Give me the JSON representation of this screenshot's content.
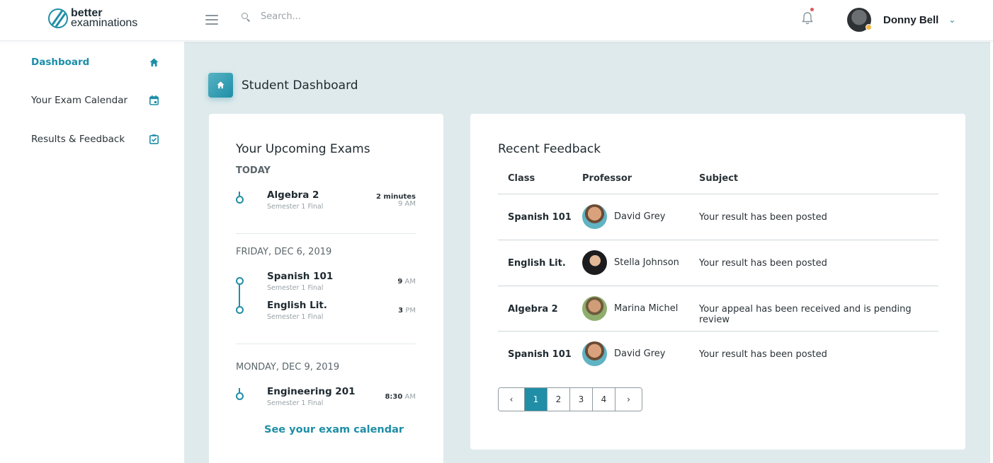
{
  "header": {
    "logo_line1": "better",
    "logo_line2": "examinations",
    "search_placeholder": "Search...",
    "user_name": "Donny Bell"
  },
  "sidebar": {
    "items": [
      {
        "label": "Dashboard",
        "icon": "home-icon",
        "active": true
      },
      {
        "label": "Your Exam Calendar",
        "icon": "calendar-icon",
        "active": false
      },
      {
        "label": "Results & Feedback",
        "icon": "clipboard-check-icon",
        "active": false
      }
    ]
  },
  "page": {
    "title": "Student Dashboard"
  },
  "upcoming": {
    "title": "Your Upcoming Exams",
    "groups": [
      {
        "day": "TODAY",
        "exams": [
          {
            "name": "Algebra 2",
            "sub": "Semester 1 Final",
            "time_main": "2 minutes",
            "time_sub": "9 AM"
          }
        ]
      },
      {
        "day": "FRIDAY, DEC 6, 2019",
        "exams": [
          {
            "name": "Spanish 101",
            "sub": "Semester 1 Final",
            "time_num": "9",
            "time_unit": "AM"
          },
          {
            "name": "English Lit.",
            "sub": "Semester 1 Final",
            "time_num": "3",
            "time_unit": "PM"
          }
        ]
      },
      {
        "day": "MONDAY, DEC 9, 2019",
        "exams": [
          {
            "name": "Engineering 201",
            "sub": "Semester 1 Final",
            "time_num": "8:30",
            "time_unit": "AM"
          }
        ]
      }
    ],
    "link": "See your exam calendar"
  },
  "feedback": {
    "title": "Recent Feedback",
    "columns": [
      "Class",
      "Professor",
      "Subject"
    ],
    "rows": [
      {
        "class": "Spanish 101",
        "professor": "David Grey",
        "subject": "Your result has been posted"
      },
      {
        "class": "English Lit.",
        "professor": "Stella Johnson",
        "subject": "Your result has been posted"
      },
      {
        "class": "Algebra 2",
        "professor": "Marina Michel",
        "subject": "Your appeal has been received and is pending review"
      },
      {
        "class": "Spanish 101",
        "professor": "David Grey",
        "subject": "Your result has been posted"
      }
    ],
    "pagination": {
      "prev": "‹",
      "pages": [
        "1",
        "2",
        "3",
        "4"
      ],
      "current": "1",
      "next": "›"
    }
  },
  "colors": {
    "accent": "#1f8ea6",
    "background": "#dfeaec",
    "notification_dot": "#e0575b"
  }
}
